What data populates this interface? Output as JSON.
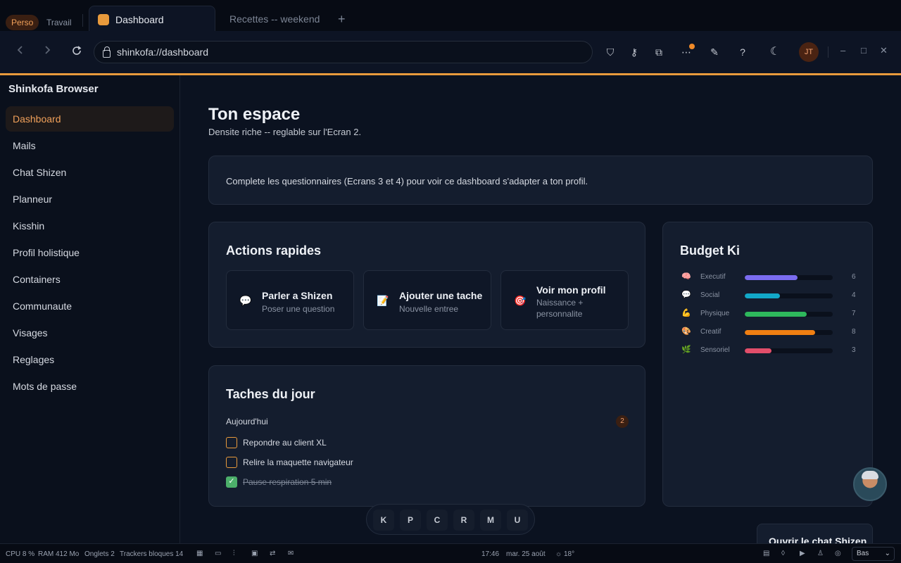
{
  "profiles": [
    "Perso",
    "Travail"
  ],
  "tabs": [
    {
      "title": "Dashboard"
    },
    {
      "title": "Recettes -- weekend"
    }
  ],
  "toolbar": {
    "url": "shinkofa://dashboard",
    "avatar_initials": "JT",
    "back_icon": "chevron-left-icon",
    "forward_icon": "chevron-right-icon",
    "reload_icon": "reload-icon"
  },
  "sidebar": {
    "title": "Shinkofa Browser",
    "items": [
      "Dashboard",
      "Mails",
      "Chat Shizen",
      "Planneur",
      "Kisshin",
      "Profil holistique",
      "Containers",
      "Communaute",
      "Visages",
      "Reglages",
      "Mots de passe"
    ]
  },
  "main": {
    "title": "Ton espace",
    "subtitle": "Densite riche -- reglable sur l'Ecran 2.",
    "banner": "Complete les questionnaires (Ecrans 3 et 4) pour voir ce dashboard s'adapter a ton profil."
  },
  "actions": {
    "title": "Actions rapides",
    "items": [
      {
        "label": "Parler a Shizen",
        "sub": "Poser une question"
      },
      {
        "label": "Ajouter une tache",
        "sub": "Nouvelle entree"
      },
      {
        "label": "Voir mon profil",
        "sub": "Naissance + personnalite"
      }
    ]
  },
  "tasks": {
    "title": "Taches du jour",
    "day_label": "Aujourd'hui",
    "count": "2",
    "items": [
      {
        "text": "Repondre au client XL",
        "done": false
      },
      {
        "text": "Relire la maquette navigateur",
        "done": false
      },
      {
        "text": "Pause respiration 5 min",
        "done": true
      }
    ]
  },
  "budget": {
    "title": "Budget Ki",
    "items": [
      {
        "label": "Executif",
        "value": "6",
        "fraction": 0.6,
        "color": "#7b6cf0"
      },
      {
        "label": "Social",
        "value": "4",
        "fraction": 0.4,
        "color": "#12a8c8"
      },
      {
        "label": "Physique",
        "value": "7",
        "fraction": 0.7,
        "color": "#2eb85c"
      },
      {
        "label": "Creatif",
        "value": "8",
        "fraction": 0.8,
        "color": "#f07f12"
      },
      {
        "label": "Sensoriel",
        "value": "3",
        "fraction": 0.3,
        "color": "#e24e6a"
      }
    ]
  },
  "dock": [
    "K",
    "P",
    "C",
    "R",
    "M",
    "U"
  ],
  "chat_button": "Ouvrir le chat Shizen",
  "statusbar": {
    "cpu": "CPU 8 %",
    "ram": "RAM 412 Mo",
    "tabs": "Onglets 2",
    "trackers": "Trackers bloques 14",
    "time": "17:46",
    "date": "mar. 25 août",
    "weather": "☼ 18°",
    "position_select": "Bas"
  },
  "colors": {
    "accent": "#e89a3c",
    "background": "#0b1220",
    "card": "#141d2e"
  }
}
